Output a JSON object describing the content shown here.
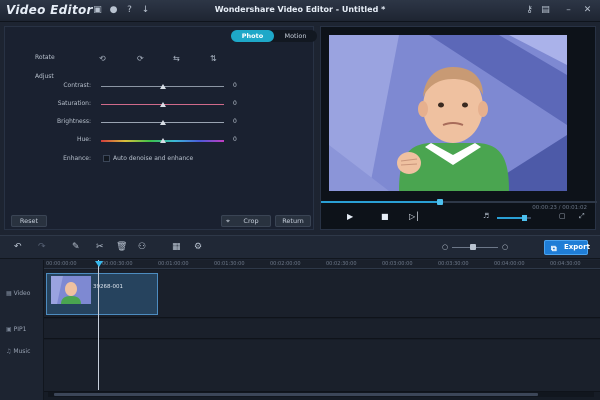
{
  "titlebar": {
    "app_name": "Video Editor",
    "window_title": "Wondershare Video Editor - Untitled *",
    "icons": [
      "save-icon",
      "chat-icon",
      "help-icon",
      "download-icon",
      "key-icon",
      "cart-icon",
      "minimize-icon",
      "close-icon"
    ]
  },
  "mode_tabs": {
    "photo": "Photo",
    "motion": "Motion",
    "active": "photo"
  },
  "edit": {
    "rotate_label": "Rotate",
    "rotate_icons": [
      "rotate-left-icon",
      "rotate-right-icon",
      "flip-horizontal-icon",
      "flip-vertical-icon"
    ],
    "adjust_label": "Adjust",
    "sliders": [
      {
        "label": "Contrast:",
        "value": "0",
        "level": 0.5,
        "track_color": "#8c96a4"
      },
      {
        "label": "Saturation:",
        "value": "0",
        "level": 0.5,
        "track_color": "#d06a8a"
      },
      {
        "label": "Brightness:",
        "value": "0",
        "level": 0.5,
        "track_color": "#9aa4b2"
      },
      {
        "label": "Hue:",
        "value": "0",
        "level": 0.5,
        "track_color": "rainbow"
      }
    ],
    "enhance_label": "Enhance:",
    "enhance_option": "Auto denoise and enhance",
    "reset": "Reset",
    "crop": "Crop",
    "return": "Return"
  },
  "preview": {
    "timecode": "00:00:23 / 00:01:02",
    "progress": 0.43,
    "volume": 0.8,
    "controls": [
      "play-icon",
      "stop-icon",
      "next-frame-icon",
      "volume-icon",
      "snapshot-icon",
      "fullscreen-icon"
    ]
  },
  "toolbar": {
    "tools": [
      "undo-icon",
      "redo-icon",
      "edit-icon",
      "cut-icon",
      "delete-icon",
      "record-icon",
      "snapshot-icon",
      "settings-icon"
    ],
    "zoom": 0.4,
    "export": "Export"
  },
  "timeline": {
    "ticks": [
      "00:00:00:00",
      "00:00:30:00",
      "00:01:00:00",
      "00:01:30:00",
      "00:02:00:00",
      "00:02:30:00",
      "00:03:00:00",
      "00:03:30:00",
      "00:04:00:00",
      "00:04:30:00"
    ],
    "tracks": [
      {
        "label": "Video"
      },
      {
        "label": "PIP1"
      },
      {
        "label": "Music"
      }
    ],
    "clip_name": "39268-001"
  },
  "colors": {
    "accent": "#1ea8c8",
    "export": "#1f7dd6",
    "clip": "#26435e"
  }
}
